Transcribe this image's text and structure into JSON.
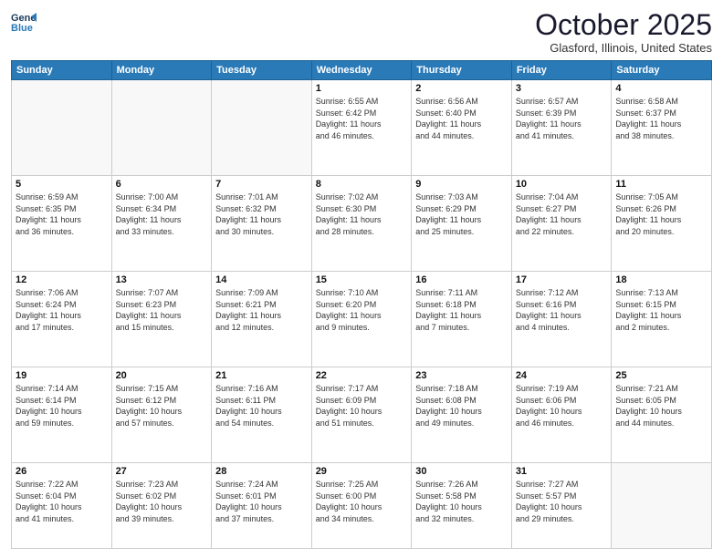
{
  "header": {
    "logo_line1": "General",
    "logo_line2": "Blue",
    "month": "October 2025",
    "location": "Glasford, Illinois, United States"
  },
  "days_of_week": [
    "Sunday",
    "Monday",
    "Tuesday",
    "Wednesday",
    "Thursday",
    "Friday",
    "Saturday"
  ],
  "weeks": [
    [
      {
        "day": "",
        "info": ""
      },
      {
        "day": "",
        "info": ""
      },
      {
        "day": "",
        "info": ""
      },
      {
        "day": "1",
        "info": "Sunrise: 6:55 AM\nSunset: 6:42 PM\nDaylight: 11 hours\nand 46 minutes."
      },
      {
        "day": "2",
        "info": "Sunrise: 6:56 AM\nSunset: 6:40 PM\nDaylight: 11 hours\nand 44 minutes."
      },
      {
        "day": "3",
        "info": "Sunrise: 6:57 AM\nSunset: 6:39 PM\nDaylight: 11 hours\nand 41 minutes."
      },
      {
        "day": "4",
        "info": "Sunrise: 6:58 AM\nSunset: 6:37 PM\nDaylight: 11 hours\nand 38 minutes."
      }
    ],
    [
      {
        "day": "5",
        "info": "Sunrise: 6:59 AM\nSunset: 6:35 PM\nDaylight: 11 hours\nand 36 minutes."
      },
      {
        "day": "6",
        "info": "Sunrise: 7:00 AM\nSunset: 6:34 PM\nDaylight: 11 hours\nand 33 minutes."
      },
      {
        "day": "7",
        "info": "Sunrise: 7:01 AM\nSunset: 6:32 PM\nDaylight: 11 hours\nand 30 minutes."
      },
      {
        "day": "8",
        "info": "Sunrise: 7:02 AM\nSunset: 6:30 PM\nDaylight: 11 hours\nand 28 minutes."
      },
      {
        "day": "9",
        "info": "Sunrise: 7:03 AM\nSunset: 6:29 PM\nDaylight: 11 hours\nand 25 minutes."
      },
      {
        "day": "10",
        "info": "Sunrise: 7:04 AM\nSunset: 6:27 PM\nDaylight: 11 hours\nand 22 minutes."
      },
      {
        "day": "11",
        "info": "Sunrise: 7:05 AM\nSunset: 6:26 PM\nDaylight: 11 hours\nand 20 minutes."
      }
    ],
    [
      {
        "day": "12",
        "info": "Sunrise: 7:06 AM\nSunset: 6:24 PM\nDaylight: 11 hours\nand 17 minutes."
      },
      {
        "day": "13",
        "info": "Sunrise: 7:07 AM\nSunset: 6:23 PM\nDaylight: 11 hours\nand 15 minutes."
      },
      {
        "day": "14",
        "info": "Sunrise: 7:09 AM\nSunset: 6:21 PM\nDaylight: 11 hours\nand 12 minutes."
      },
      {
        "day": "15",
        "info": "Sunrise: 7:10 AM\nSunset: 6:20 PM\nDaylight: 11 hours\nand 9 minutes."
      },
      {
        "day": "16",
        "info": "Sunrise: 7:11 AM\nSunset: 6:18 PM\nDaylight: 11 hours\nand 7 minutes."
      },
      {
        "day": "17",
        "info": "Sunrise: 7:12 AM\nSunset: 6:16 PM\nDaylight: 11 hours\nand 4 minutes."
      },
      {
        "day": "18",
        "info": "Sunrise: 7:13 AM\nSunset: 6:15 PM\nDaylight: 11 hours\nand 2 minutes."
      }
    ],
    [
      {
        "day": "19",
        "info": "Sunrise: 7:14 AM\nSunset: 6:14 PM\nDaylight: 10 hours\nand 59 minutes."
      },
      {
        "day": "20",
        "info": "Sunrise: 7:15 AM\nSunset: 6:12 PM\nDaylight: 10 hours\nand 57 minutes."
      },
      {
        "day": "21",
        "info": "Sunrise: 7:16 AM\nSunset: 6:11 PM\nDaylight: 10 hours\nand 54 minutes."
      },
      {
        "day": "22",
        "info": "Sunrise: 7:17 AM\nSunset: 6:09 PM\nDaylight: 10 hours\nand 51 minutes."
      },
      {
        "day": "23",
        "info": "Sunrise: 7:18 AM\nSunset: 6:08 PM\nDaylight: 10 hours\nand 49 minutes."
      },
      {
        "day": "24",
        "info": "Sunrise: 7:19 AM\nSunset: 6:06 PM\nDaylight: 10 hours\nand 46 minutes."
      },
      {
        "day": "25",
        "info": "Sunrise: 7:21 AM\nSunset: 6:05 PM\nDaylight: 10 hours\nand 44 minutes."
      }
    ],
    [
      {
        "day": "26",
        "info": "Sunrise: 7:22 AM\nSunset: 6:04 PM\nDaylight: 10 hours\nand 41 minutes."
      },
      {
        "day": "27",
        "info": "Sunrise: 7:23 AM\nSunset: 6:02 PM\nDaylight: 10 hours\nand 39 minutes."
      },
      {
        "day": "28",
        "info": "Sunrise: 7:24 AM\nSunset: 6:01 PM\nDaylight: 10 hours\nand 37 minutes."
      },
      {
        "day": "29",
        "info": "Sunrise: 7:25 AM\nSunset: 6:00 PM\nDaylight: 10 hours\nand 34 minutes."
      },
      {
        "day": "30",
        "info": "Sunrise: 7:26 AM\nSunset: 5:58 PM\nDaylight: 10 hours\nand 32 minutes."
      },
      {
        "day": "31",
        "info": "Sunrise: 7:27 AM\nSunset: 5:57 PM\nDaylight: 10 hours\nand 29 minutes."
      },
      {
        "day": "",
        "info": ""
      }
    ]
  ]
}
